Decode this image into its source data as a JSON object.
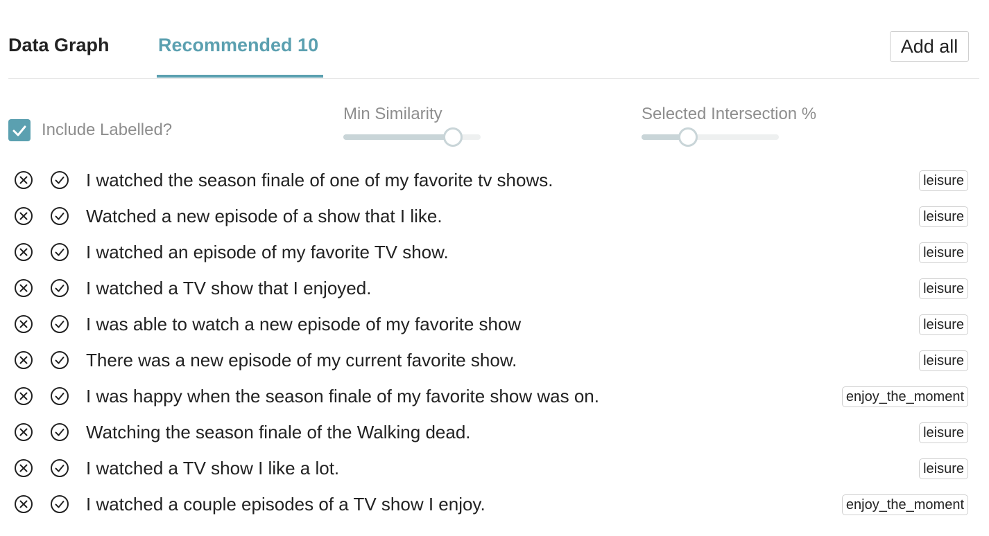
{
  "tabs": {
    "data_graph": "Data Graph",
    "recommended": "Recommended 10",
    "active": "recommended"
  },
  "toolbar": {
    "add_all_label": "Add all"
  },
  "filters": {
    "include_labelled": {
      "label": "Include Labelled?",
      "checked": true
    },
    "min_similarity": {
      "label": "Min Similarity",
      "value_fraction": 0.8
    },
    "selected_intersection": {
      "label": "Selected Intersection %",
      "value_fraction": 0.34
    }
  },
  "colors": {
    "accent": "#5ba0b0",
    "muted_text": "#8e8e8e",
    "slider": "#c9d5d8"
  },
  "icons": {
    "reject": "circle-x-icon",
    "accept": "circle-check-icon"
  },
  "rows": [
    {
      "text": "I watched the season finale of one of my favorite tv shows.",
      "tag": "leisure"
    },
    {
      "text": "Watched a new episode of a show that I like.",
      "tag": "leisure"
    },
    {
      "text": "I watched an episode of my favorite TV show.",
      "tag": "leisure"
    },
    {
      "text": "I watched a TV show that I enjoyed.",
      "tag": "leisure"
    },
    {
      "text": "I was able to watch a new episode of my favorite show",
      "tag": "leisure"
    },
    {
      "text": "There was a new episode of my current favorite show.",
      "tag": "leisure"
    },
    {
      "text": "I was happy when the season finale of my favorite show was on.",
      "tag": "enjoy_the_moment"
    },
    {
      "text": "Watching the season finale of the Walking dead.",
      "tag": "leisure"
    },
    {
      "text": "I watched a TV show I like a lot.",
      "tag": "leisure"
    },
    {
      "text": "I watched a couple episodes of a TV show I enjoy.",
      "tag": "enjoy_the_moment"
    }
  ]
}
